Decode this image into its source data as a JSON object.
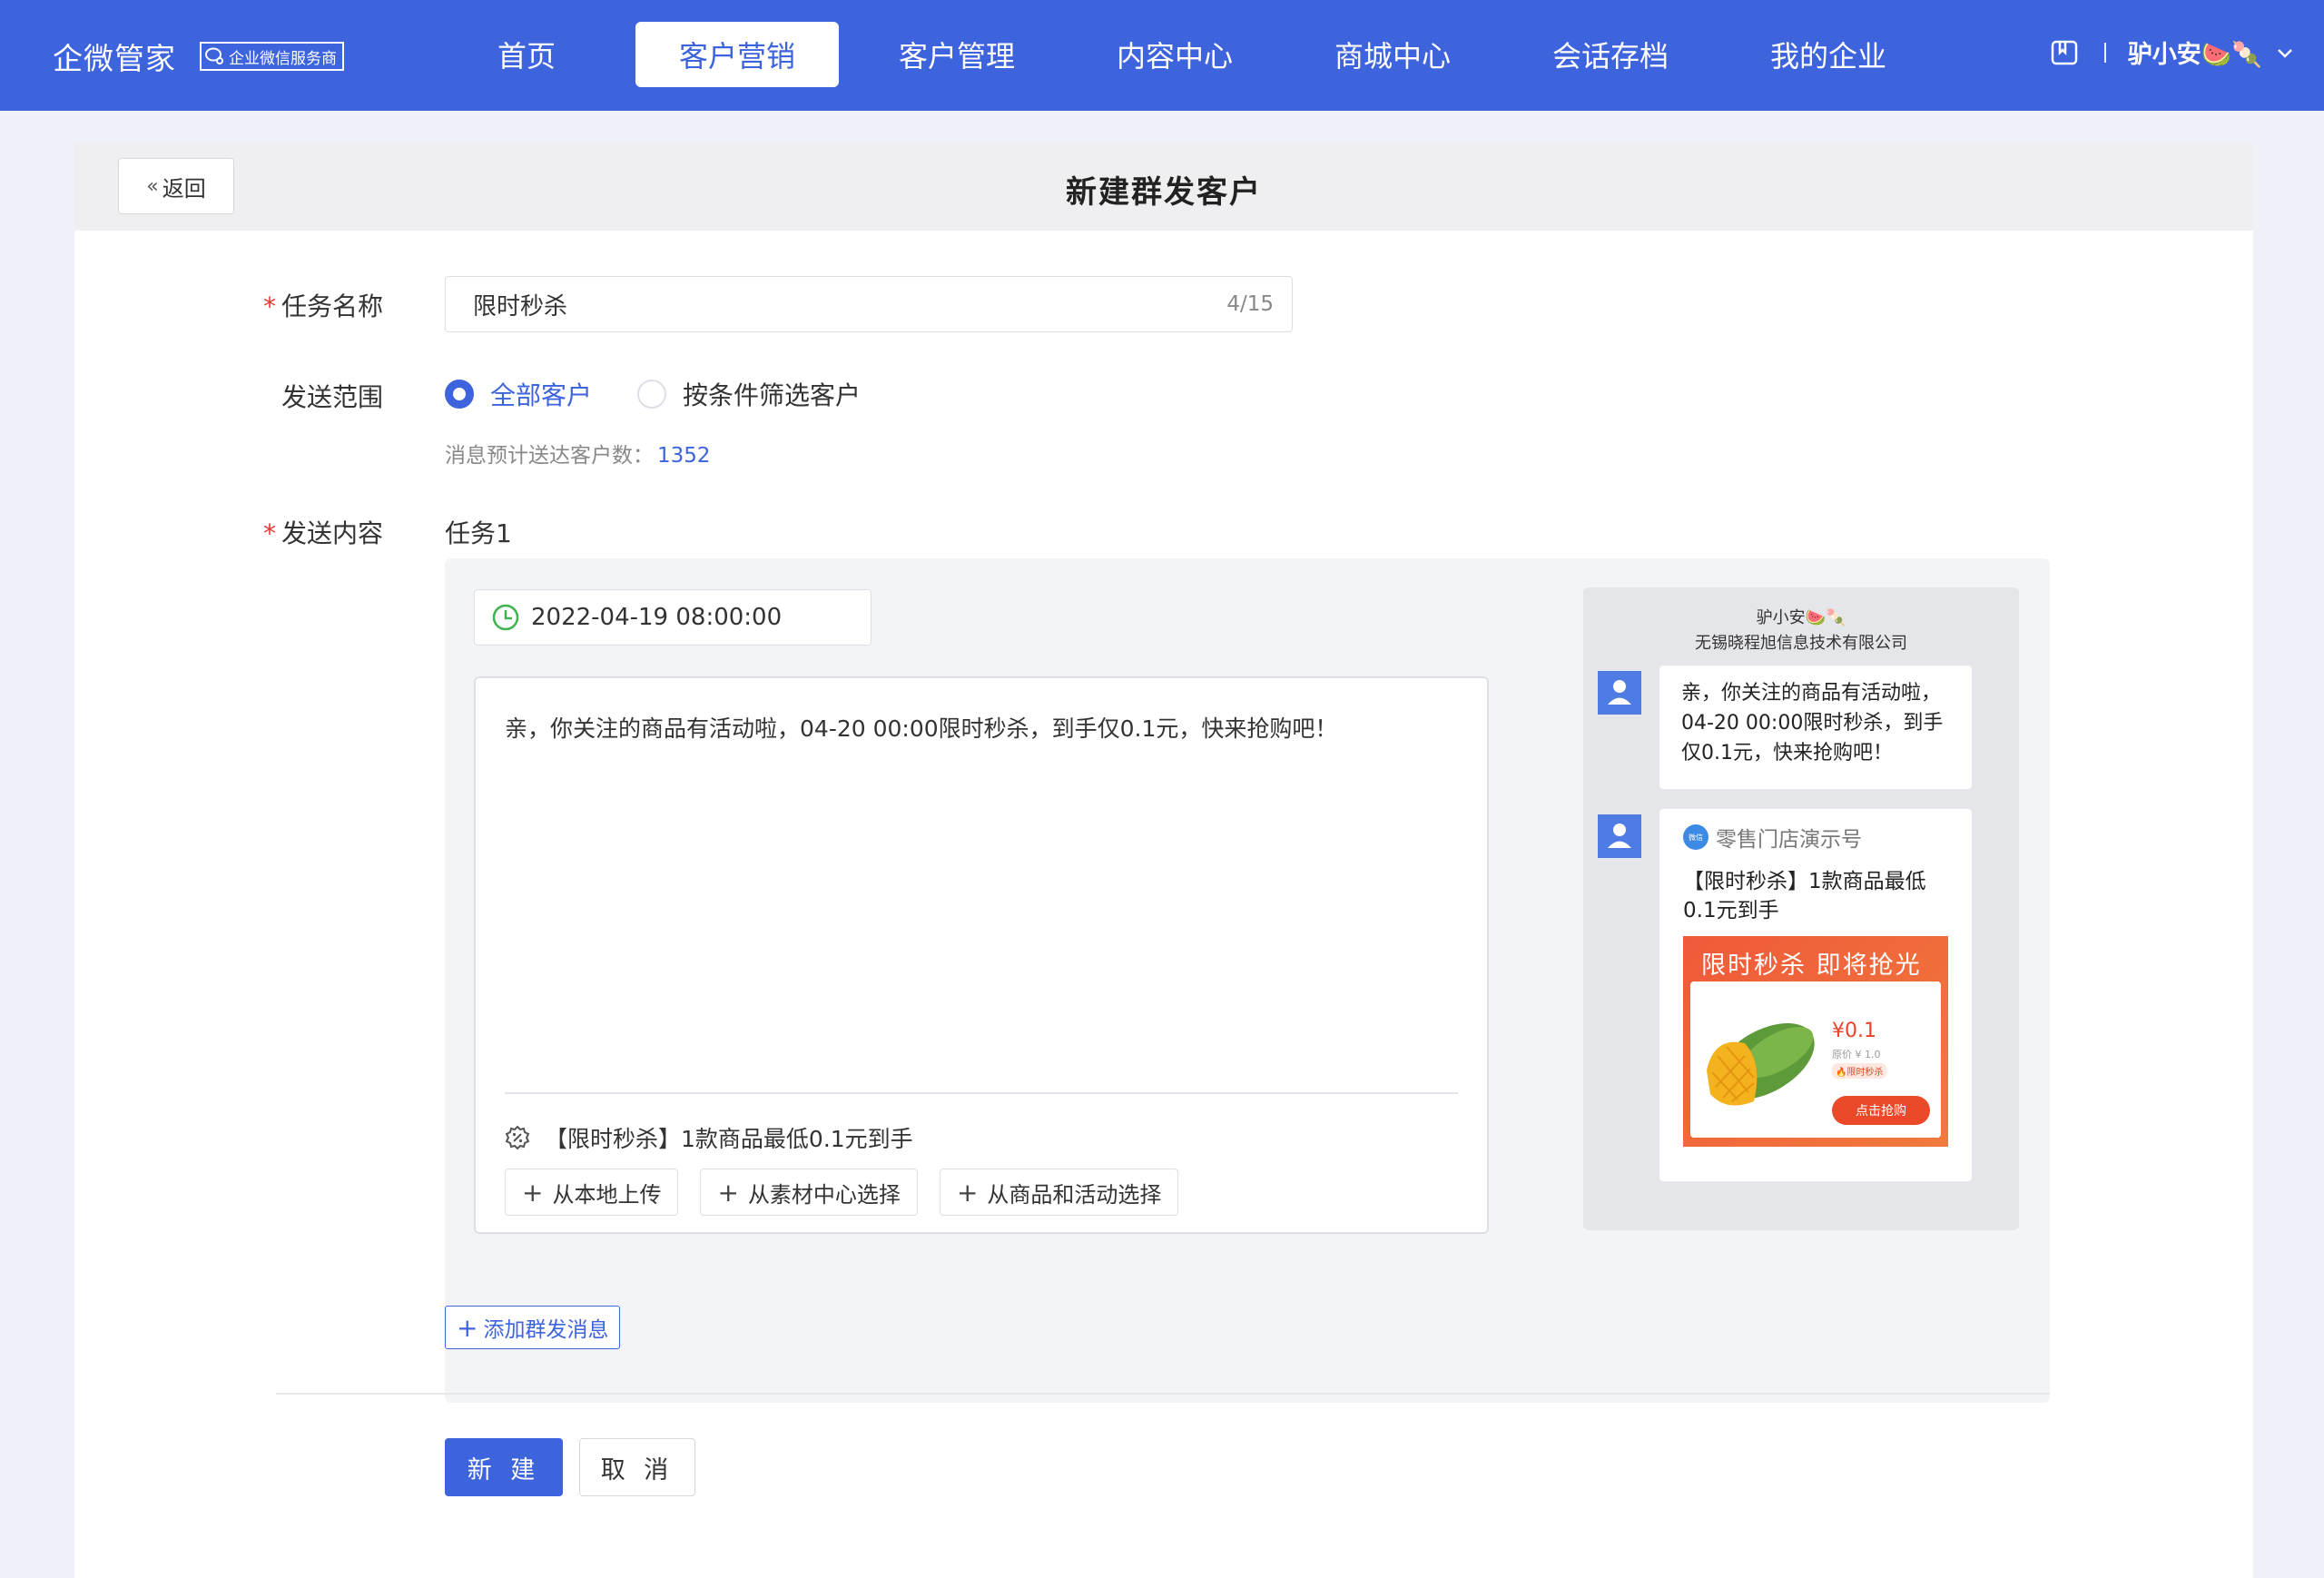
{
  "topbar": {
    "brand": "企微管家",
    "badge": "企业微信服务商",
    "nav": [
      "首页",
      "客户营销",
      "客户管理",
      "内容中心",
      "商城中心",
      "会话存档",
      "我的企业"
    ],
    "active_index": 1,
    "user": "驴小安🍉🍡",
    "accent": "#3d63dd"
  },
  "header": {
    "back": "返回",
    "title": "新建群发客户"
  },
  "form": {
    "task_name_label": "任务名称",
    "task_name_value": "限时秒杀",
    "task_name_count": "4/15",
    "scope_label": "发送范围",
    "scope_options": [
      "全部客户",
      "按条件筛选客户"
    ],
    "scope_selected": 0,
    "estimate_label": "消息预计送达客户数：",
    "estimate_value": "1352",
    "content_label": "发送内容",
    "task_title": "任务1",
    "datetime": "2022-04-19 08:00:00",
    "message": "亲，你关注的商品有活动啦，04-20 00:00限时秒杀，到手仅0.1元，快来抢购吧！",
    "attachment": "【限时秒杀】1款商品最低0.1元到手",
    "buttons": [
      "从本地上传",
      "从素材中心选择",
      "从商品和活动选择"
    ],
    "add_message": "添加群发消息",
    "submit": "新 建",
    "cancel": "取 消"
  },
  "preview": {
    "sender": "驴小安🍉🍡",
    "company": "无锡晓程旭信息技术有限公司",
    "bubble_text": "亲，你关注的商品有活动啦，04-20 00:00限时秒杀，到手仅0.1元，快来抢购吧！",
    "mini_name": "零售门店演示号",
    "mini_logo": "微信",
    "mini_title": "【限时秒杀】1款商品最低0.1元到手",
    "promo_title": "限时秒杀  即将抢光",
    "price": "¥0.1",
    "orig_price": "原价 ¥ 1.0",
    "tag": "🔥限时秒杀",
    "grab": "点击抢购"
  }
}
